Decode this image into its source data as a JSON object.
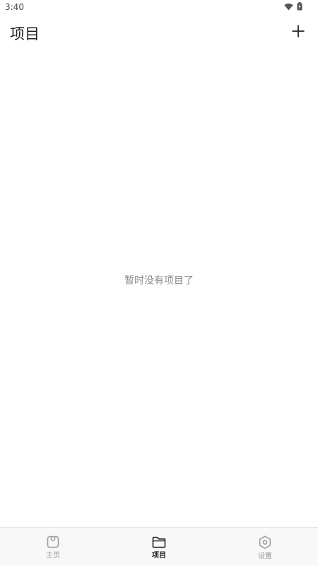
{
  "status_bar": {
    "time": "3:40",
    "wifi_icon": "wifi-icon",
    "battery_icon": "battery-charging-icon"
  },
  "header": {
    "title": "项目",
    "add_icon": "plus-icon"
  },
  "main": {
    "empty_message": "暂时没有项目了"
  },
  "bottom_nav": {
    "items": [
      {
        "label": "主页",
        "icon": "bag-icon",
        "active": false
      },
      {
        "label": "项目",
        "icon": "folder-icon",
        "active": true
      },
      {
        "label": "设置",
        "icon": "hexagon-settings-icon",
        "active": false
      }
    ]
  },
  "colors": {
    "active": "#222222",
    "inactive": "#9a9a9a",
    "nav_background": "#f8f8f8"
  }
}
